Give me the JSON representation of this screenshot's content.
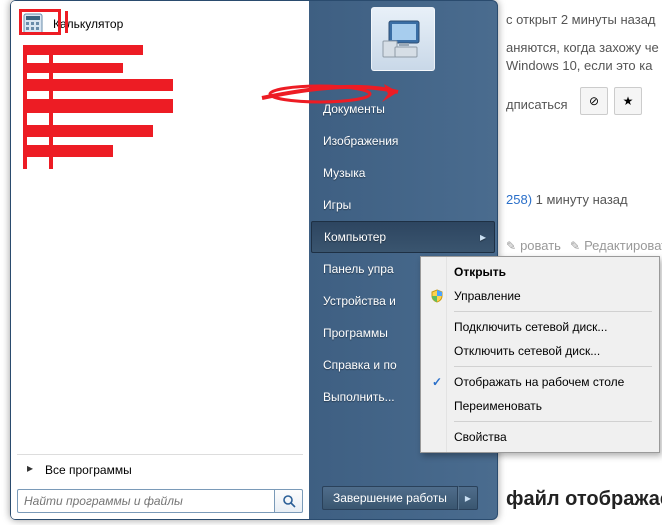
{
  "bg": {
    "t1": "с открыт 2 минуты назад",
    "t2": "аняются, когда захожу че",
    "t3": " Windows 10, если это ка",
    "sub": "дписаться",
    "answ": "258)",
    "answ_time": " 1 минуту назад",
    "act1": "ровать",
    "act2": "Редактировать",
    "bottom": "файл отображается к"
  },
  "left": {
    "calc": "Калькулятор",
    "all": "Все программы",
    "search_ph": "Найти программы и файлы"
  },
  "right": {
    "items": [
      "Документы",
      "Изображения",
      "Музыка",
      "Игры",
      "Компьютер",
      "Панель упра",
      "Устройства и",
      "Программы",
      "Справка и по",
      "Выполнить..."
    ],
    "shutdown": "Завершение работы"
  },
  "ctx": {
    "open": "Открыть",
    "manage": "Управление",
    "map": "Подключить сетевой диск...",
    "unmap": "Отключить сетевой диск...",
    "show": "Отображать на рабочем столе",
    "rename": "Переименовать",
    "props": "Свойства"
  }
}
